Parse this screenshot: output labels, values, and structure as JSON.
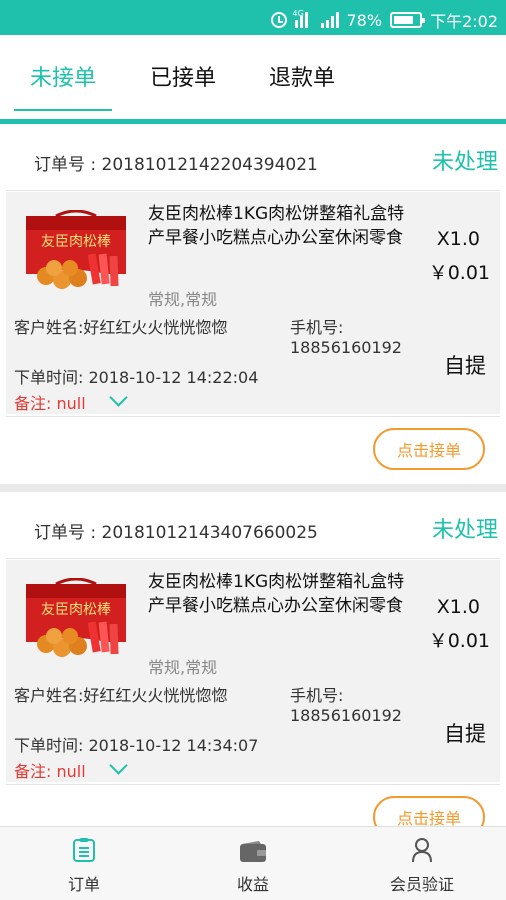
{
  "status_bar": {
    "battery": "78%",
    "time": "下午2:02",
    "network": "4G",
    "battery_level": 0.78,
    "icons": [
      "alarm-icon",
      "signal-icon",
      "signal-icon",
      "battery-icon"
    ]
  },
  "tabs": [
    {
      "label": "未接单",
      "active": true
    },
    {
      "label": "已接单",
      "active": false
    },
    {
      "label": "退款单",
      "active": false
    }
  ],
  "colors": {
    "accent": "#1fc1ad",
    "note": "#e53935",
    "button": "#f39a2e"
  },
  "orders": [
    {
      "order_no": "订单号 : 20181012142204394021",
      "status": "未处理",
      "product_name": "友臣肉松棒1KG肉松饼整箱礼盒特产早餐小吃糕点心办公室休闲零食",
      "spec": "常规,常规",
      "quantity": "X1.0",
      "price": "￥0.01",
      "customer": "客户姓名:好红红火火恍恍惚惚",
      "phone_label": "手机号:",
      "phone": "18856160192",
      "delivery": "自提",
      "time": "下单时间:  2018-10-12 14:22:04",
      "note": "备注:  null",
      "accept_button": "点击接单",
      "image_brand": "友臣肉松棒"
    },
    {
      "order_no": "订单号 : 20181012143407660025",
      "status": "未处理",
      "product_name": "友臣肉松棒1KG肉松饼整箱礼盒特产早餐小吃糕点心办公室休闲零食",
      "spec": "常规,常规",
      "quantity": "X1.0",
      "price": "￥0.01",
      "customer": "客户姓名:好红红火火恍恍惚惚",
      "phone_label": "手机号:",
      "phone": "18856160192",
      "delivery": "自提",
      "time": "下单时间:  2018-10-12 14:34:07",
      "note": "备注:  null",
      "accept_button": "点击接单",
      "image_brand": "友臣肉松棒"
    }
  ],
  "bottom_nav": [
    {
      "label": "订单",
      "icon": "order-list-icon",
      "active": true
    },
    {
      "label": "收益",
      "icon": "wallet-icon",
      "active": false
    },
    {
      "label": "会员验证",
      "icon": "user-icon",
      "active": false
    }
  ]
}
